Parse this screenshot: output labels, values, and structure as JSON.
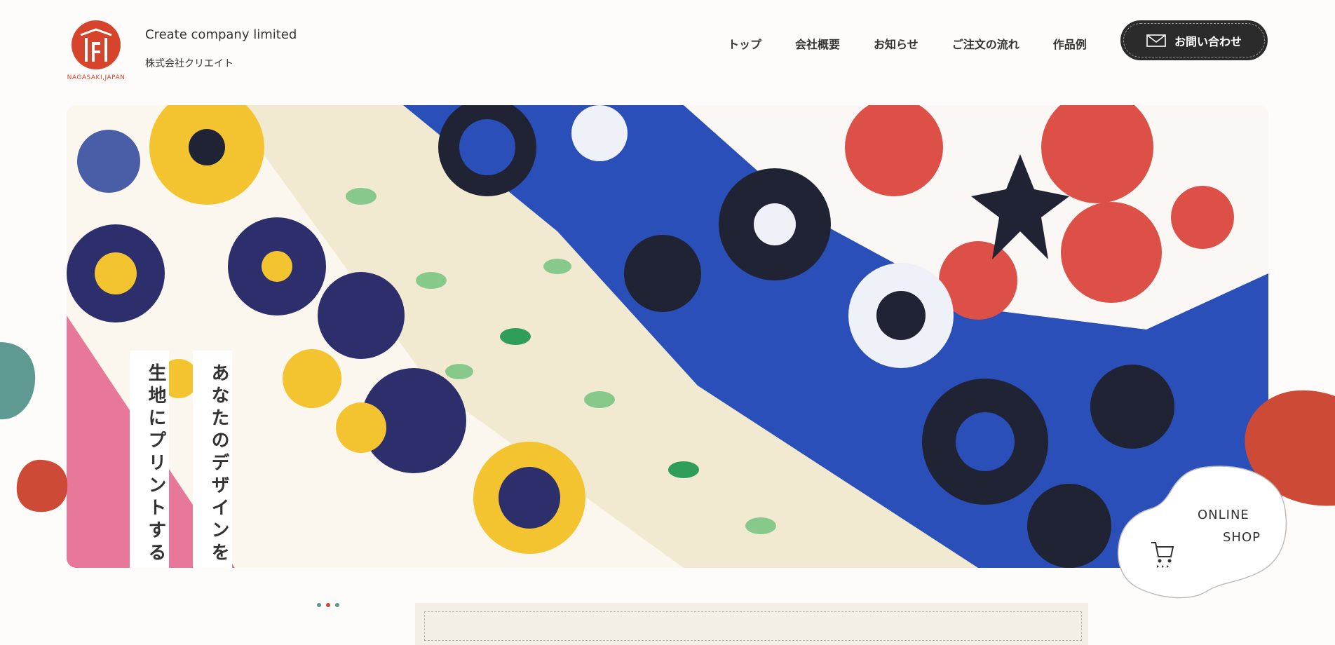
{
  "brand": {
    "location": "NAGASAKI,JAPAN",
    "company_en": "Create company limited",
    "company_jp": "株式会社クリエイト",
    "accent": "#d6442c"
  },
  "nav": {
    "items": [
      {
        "label": "トップ"
      },
      {
        "label": "会社概要"
      },
      {
        "label": "お知らせ"
      },
      {
        "label": "ご注文の流れ"
      },
      {
        "label": "作品例"
      }
    ]
  },
  "contact": {
    "label": "お問い合わせ",
    "icon": "mail-icon"
  },
  "hero": {
    "tagline_1": "生地にプリントする",
    "tagline_2": "あなたのデザインを"
  },
  "shop": {
    "line1": "ONLINE",
    "line2": "SHOP",
    "icon": "cart-icon"
  },
  "colors": {
    "teal": "#5e9a92",
    "red": "#cd4a36",
    "dark": "#2b2b2b",
    "blue": "#2a4fb8"
  }
}
